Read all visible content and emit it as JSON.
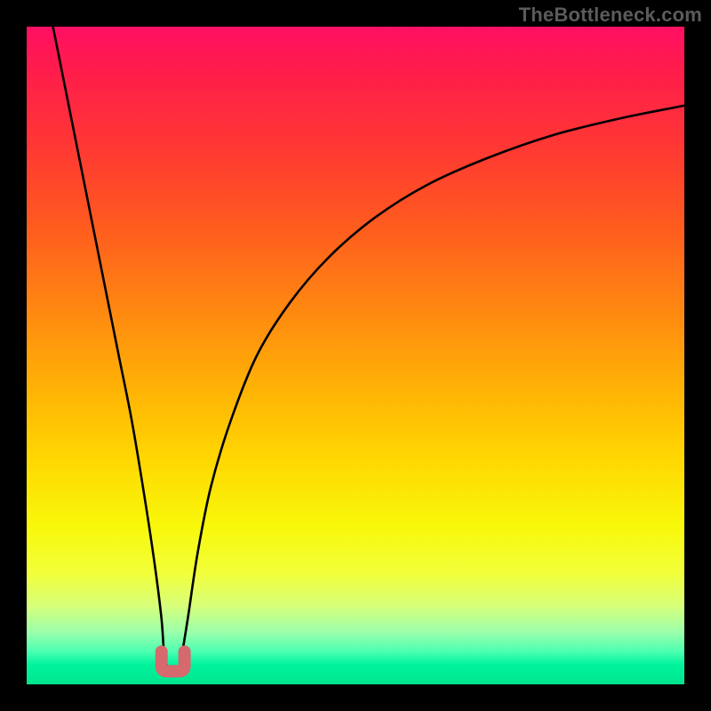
{
  "watermark": "TheBottleneck.com",
  "chart_data": {
    "type": "line",
    "title": "",
    "xlabel": "",
    "ylabel": "",
    "xlim": [
      0,
      100
    ],
    "ylim": [
      0,
      100
    ],
    "series": [
      {
        "name": "bottleneck-curve",
        "x": [
          4,
          6,
          8,
          10,
          12,
          14,
          16,
          18,
          19.5,
          20.5,
          21,
          22,
          23,
          23.5,
          24.5,
          26,
          28,
          31,
          35,
          40,
          46,
          53,
          61,
          70,
          80,
          90,
          100
        ],
        "values": [
          100,
          90,
          80,
          70,
          60,
          50,
          40,
          28,
          18,
          10,
          4,
          2,
          2,
          4,
          10,
          20,
          30,
          40,
          50,
          58,
          65,
          71,
          76,
          80,
          83.5,
          86,
          88
        ]
      }
    ],
    "minimum_marker": {
      "x_range": [
        20.5,
        24.0
      ],
      "y": 2,
      "color": "#d5696e"
    },
    "background_gradient": {
      "stops": [
        {
          "pos": 0.0,
          "color": "#ff0f63"
        },
        {
          "pos": 0.18,
          "color": "#ff3734"
        },
        {
          "pos": 0.42,
          "color": "#ff8412"
        },
        {
          "pos": 0.66,
          "color": "#ffd802"
        },
        {
          "pos": 0.83,
          "color": "#f2ff3a"
        },
        {
          "pos": 0.95,
          "color": "#4dffb1"
        },
        {
          "pos": 1.0,
          "color": "#00e58d"
        }
      ]
    }
  }
}
